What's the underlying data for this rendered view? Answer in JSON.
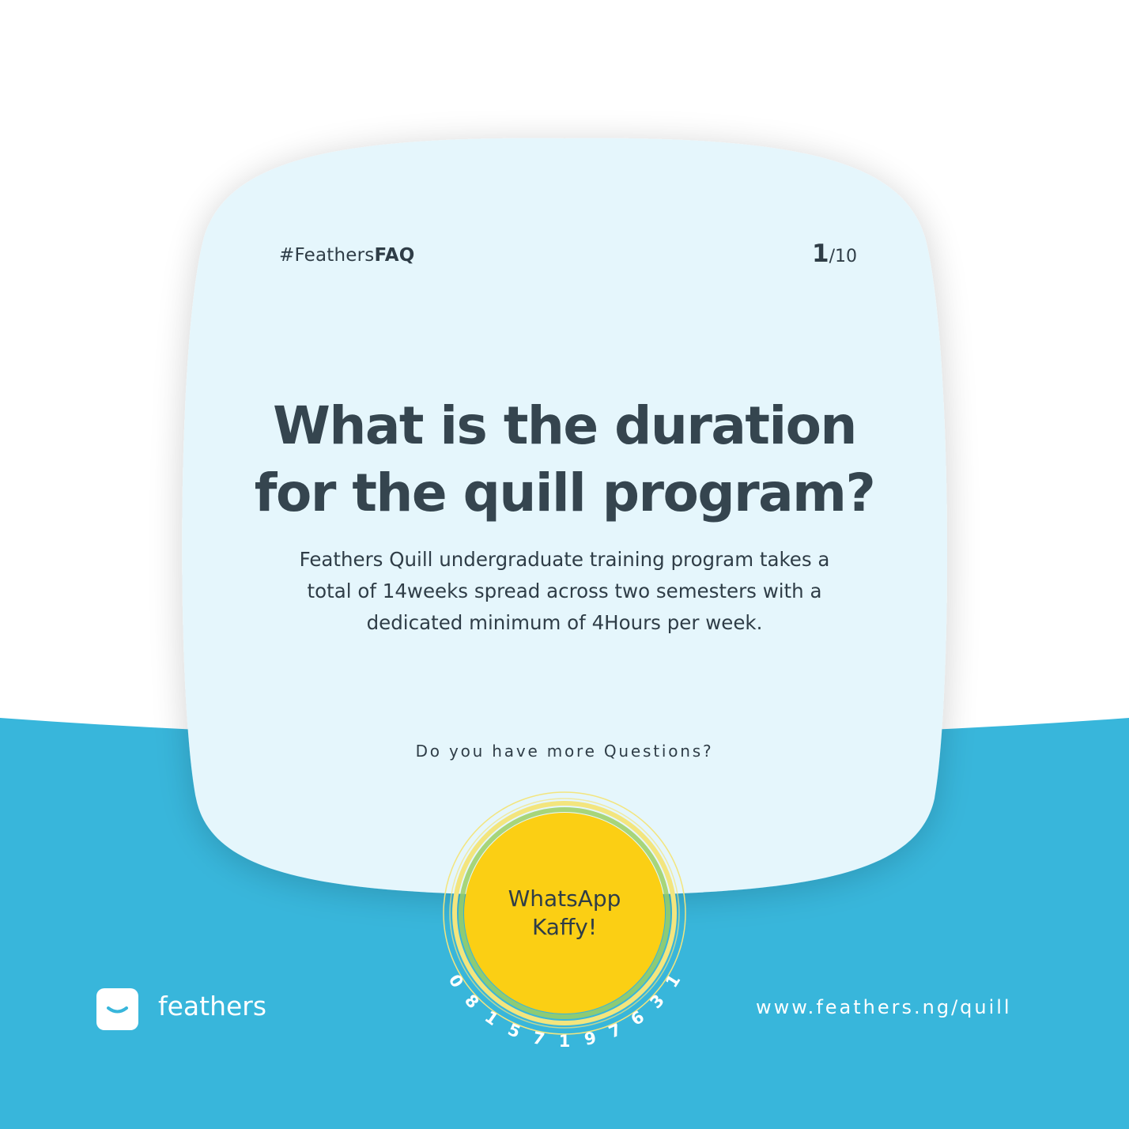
{
  "header": {
    "hashtag_prefix": "#Feathers",
    "hashtag_bold": "FAQ",
    "page_current": "1",
    "page_total": "/10"
  },
  "faq": {
    "question_line1": "What is the duration",
    "question_line2": "for the quill program?",
    "answer_line1": "Feathers Quill undergraduate training program takes a",
    "answer_line2": "total of 14weeks spread across two semesters with a",
    "answer_line3": "dedicated minimum of 4Hours per week."
  },
  "cta": {
    "prompt": "Do you have more Questions?",
    "button_line1": "WhatsApp",
    "button_line2": "Kaffy!",
    "phone_number": "08157197631"
  },
  "footer": {
    "logo_icon": "smile-icon",
    "brand_name": "feathers",
    "website": "www.feathers.ng/quill"
  },
  "colors": {
    "background": "#ffffff",
    "wave_blue": "#38b6db",
    "card": "#e5f6fc",
    "text_dark": "#35454f",
    "accent_yellow": "#fbcf14",
    "ring_yellow": "#f3e57e",
    "ring_green": "#9ccf63"
  }
}
